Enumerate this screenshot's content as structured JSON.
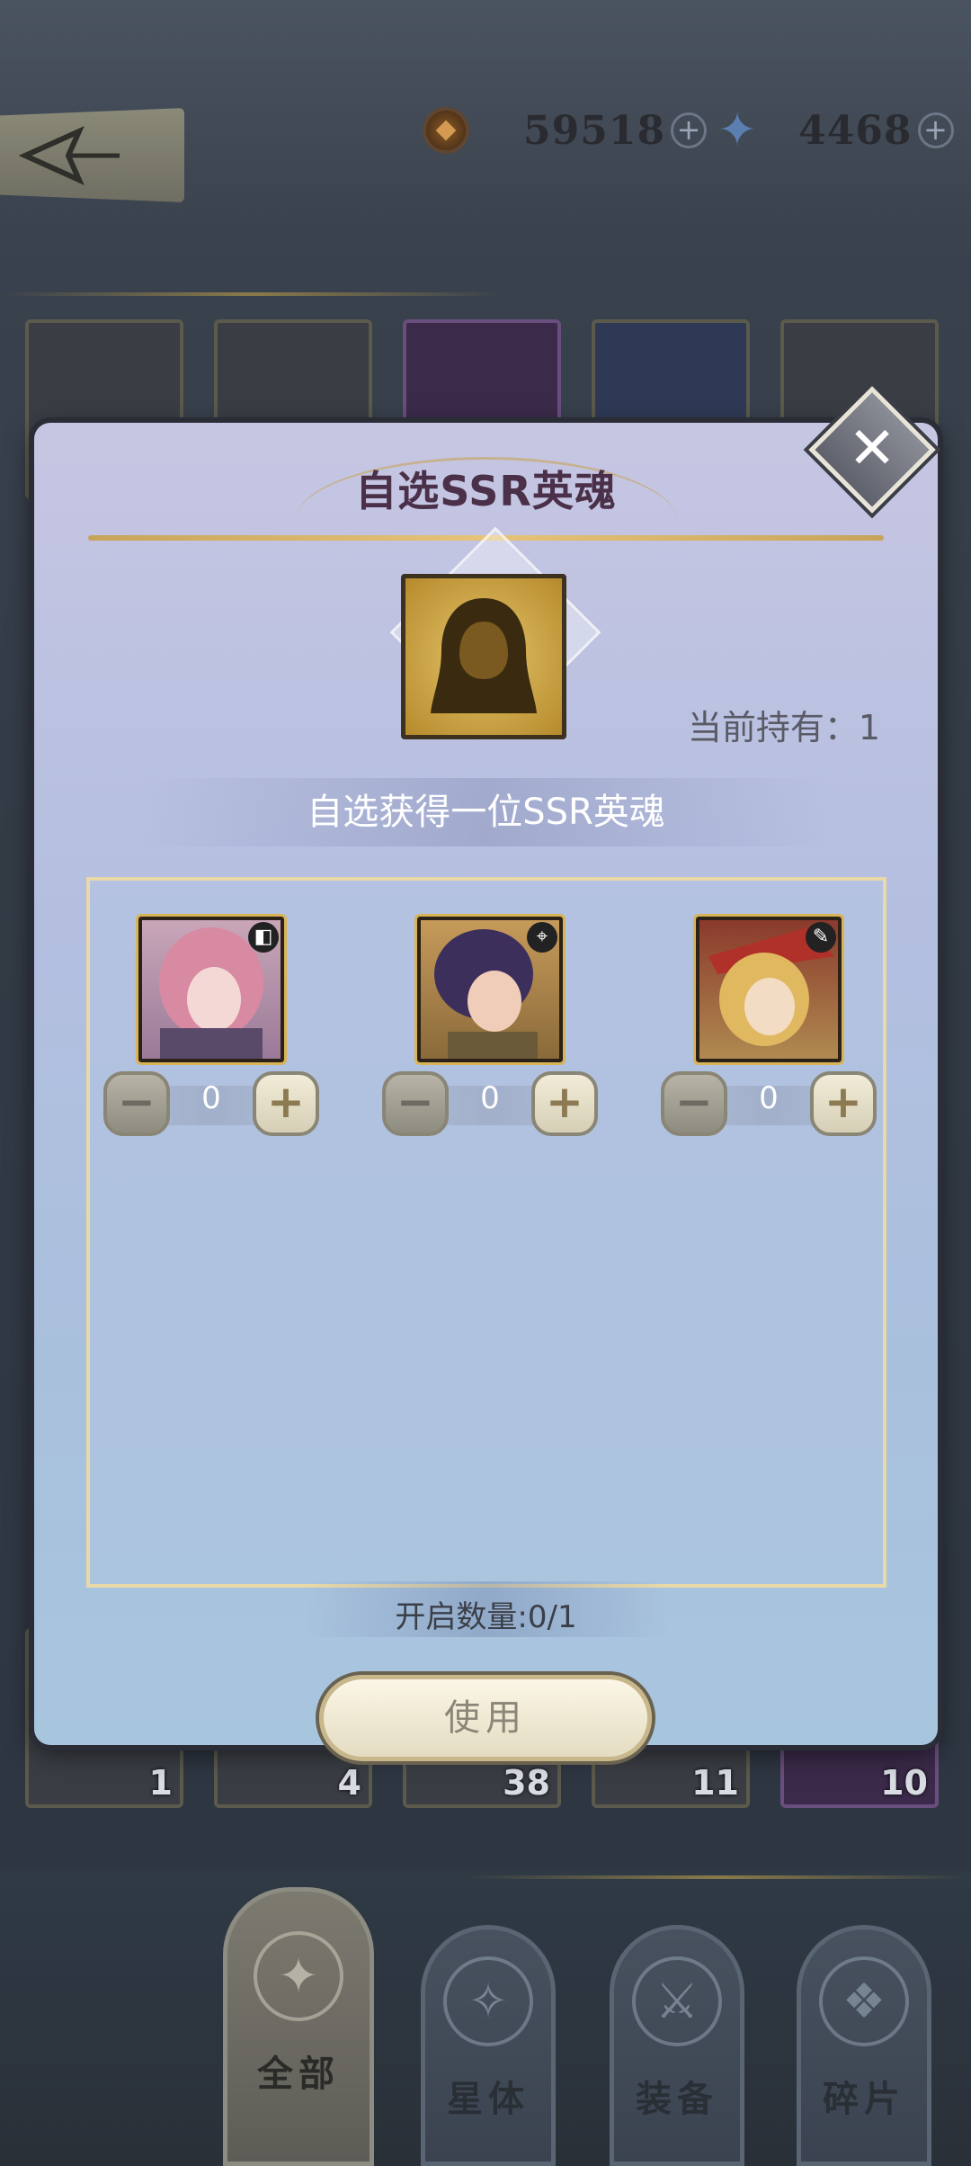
{
  "currency": {
    "gold": {
      "icon": "coin-icon",
      "value": "59518"
    },
    "gems": {
      "icon": "star-gem-icon",
      "value": "4468"
    }
  },
  "inventory": {
    "visible_counts": [
      "1",
      "4",
      "38",
      "11",
      "10"
    ]
  },
  "dialog": {
    "title": "自选SSR英魂",
    "holding_text": "当前持有：1",
    "subtitle": "自选获得一位SSR英魂",
    "heroes": [
      {
        "value": "0",
        "minus": "−",
        "plus": "+",
        "hair": "#d88aa2",
        "bg": "#c9a6b8"
      },
      {
        "value": "0",
        "minus": "−",
        "plus": "+",
        "hair": "#3c2f5c",
        "bg": "#b08a58"
      },
      {
        "value": "0",
        "minus": "−",
        "plus": "+",
        "hair": "#e0b860",
        "bg": "#8a3a2c"
      }
    ],
    "open_count": "开启数量:0/1",
    "use_label": "使用",
    "close_symbol": "✕"
  },
  "tabs": [
    {
      "label": "全部",
      "emblem": "✦",
      "active": true
    },
    {
      "label": "星体",
      "emblem": "✧",
      "active": false
    },
    {
      "label": "装备",
      "emblem": "⚔",
      "active": false
    },
    {
      "label": "碎片",
      "emblem": "❖",
      "active": false
    }
  ]
}
